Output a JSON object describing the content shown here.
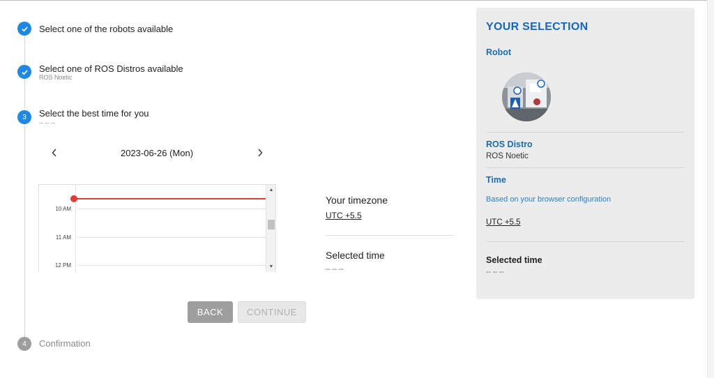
{
  "steps": [
    {
      "index": "1",
      "title": "Select one of the robots available",
      "subtitle": "",
      "state": "done"
    },
    {
      "index": "2",
      "title": "Select one of ROS Distros available",
      "subtitle": "ROS Noetic",
      "state": "done"
    },
    {
      "index": "3",
      "title": "Select the best time for you",
      "subtitle": "-- -- --",
      "state": "active"
    },
    {
      "index": "4",
      "title": "Confirmation",
      "subtitle": "",
      "state": "pending"
    }
  ],
  "scheduler": {
    "date": "2023-06-26 (Mon)",
    "prev_icon": "chevron-left-icon",
    "next_icon": "chevron-right-icon",
    "times": [
      "10 AM",
      "11 AM",
      "12 PM"
    ],
    "timezone_title": "Your timezone",
    "timezone_value": "UTC +5.5",
    "selected_title": "Selected time",
    "selected_value": "-- -- --"
  },
  "buttons": {
    "back": "BACK",
    "continue": "CONTINUE"
  },
  "selection": {
    "heading": "YOUR SELECTION",
    "robot_label": "Robot",
    "distro_label": "ROS Distro",
    "distro_value": "ROS Noetic",
    "time_label": "Time",
    "time_note": "Based on your browser configuration",
    "timezone_value": "UTC +5.5",
    "selected_title": "Selected time",
    "selected_value": "-- -- --"
  },
  "colors": {
    "accent": "#1e88e5",
    "panel_heading": "#1565c0",
    "now_line": "#e53935",
    "panel_bg": "#ececec"
  }
}
